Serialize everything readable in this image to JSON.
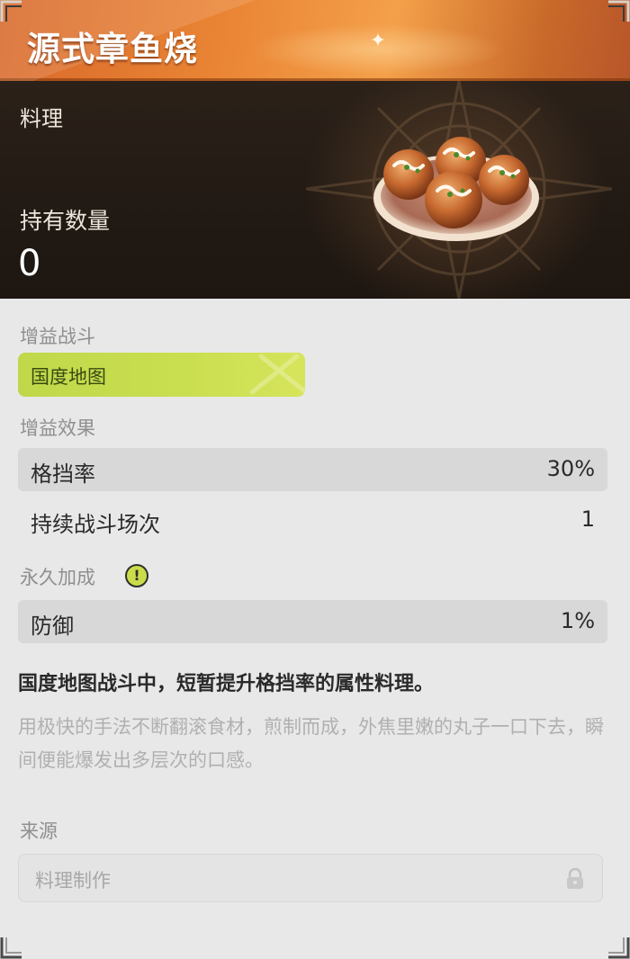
{
  "item": {
    "title": "源式章鱼烧",
    "category": "料理",
    "owned_label": "持有数量",
    "owned_count": "0",
    "image_icon": "takoyaki-plate"
  },
  "buff_battle": {
    "label": "增益战斗",
    "tag": "国度地图"
  },
  "buff_effect": {
    "label": "增益效果",
    "rows": [
      {
        "key": "格挡率",
        "value": "30%"
      },
      {
        "key": "持续战斗场次",
        "value": "1"
      }
    ]
  },
  "permanent": {
    "label": "永久加成",
    "info_icon": "!",
    "rows": [
      {
        "key": "防御",
        "value": "1%"
      }
    ]
  },
  "description": {
    "main": "国度地图战斗中，短暂提升格挡率的属性料理。",
    "flavor": "用极快的手法不断翻滚食材，煎制而成，外焦里嫩的丸子一口下去，瞬间便能爆发出多层次的口感。"
  },
  "source": {
    "label": "来源",
    "value": "料理制作",
    "icon": "lock-icon"
  },
  "colors": {
    "title_bar": "#e98434",
    "tag": "#c8de4e",
    "hero_bg": "#241b15"
  }
}
